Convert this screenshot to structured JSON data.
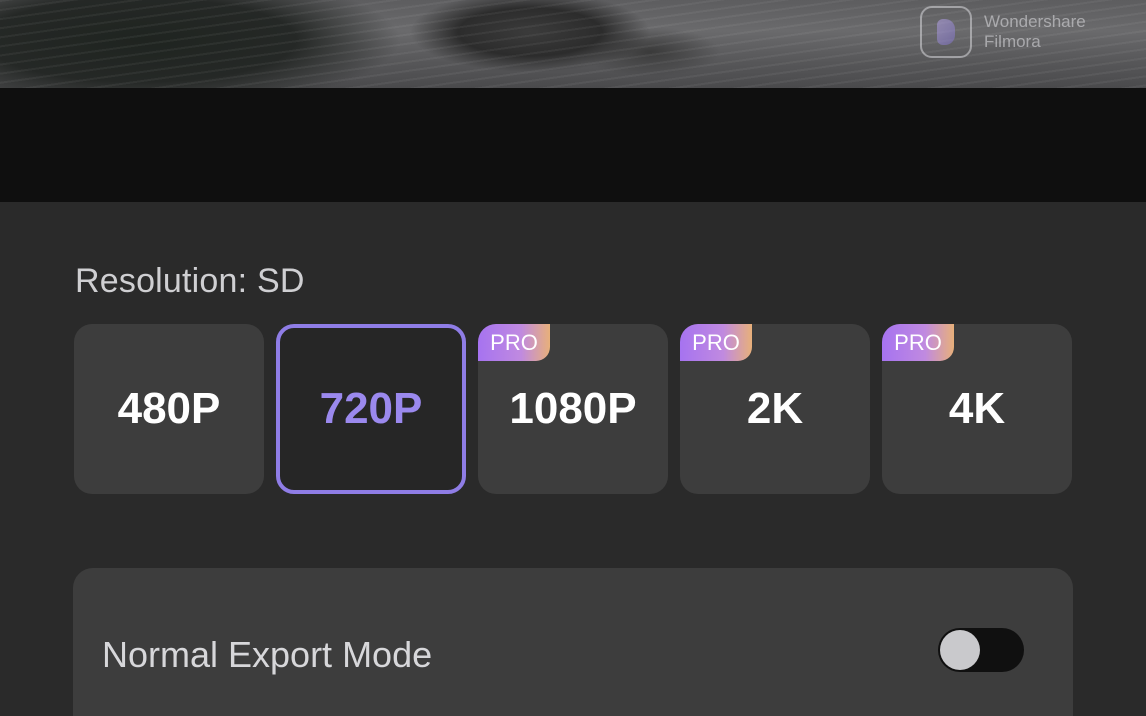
{
  "preview": {
    "watermark_line1": "Wondershare",
    "watermark_line2": "Filmora"
  },
  "resolution": {
    "label": "Resolution: SD",
    "options": [
      {
        "label": "480P",
        "pro": false,
        "selected": false
      },
      {
        "label": "720P",
        "pro": false,
        "selected": true
      },
      {
        "label": "1080P",
        "pro": true,
        "selected": false
      },
      {
        "label": "2K",
        "pro": true,
        "selected": false
      },
      {
        "label": "4K",
        "pro": true,
        "selected": false
      }
    ],
    "pro_badge": "PRO"
  },
  "export_mode": {
    "label": "Normal Export Mode",
    "enabled": false
  },
  "colors": {
    "accent": "#8f7de6",
    "background": "#2a2a2a",
    "card": "#3d3d3d"
  }
}
